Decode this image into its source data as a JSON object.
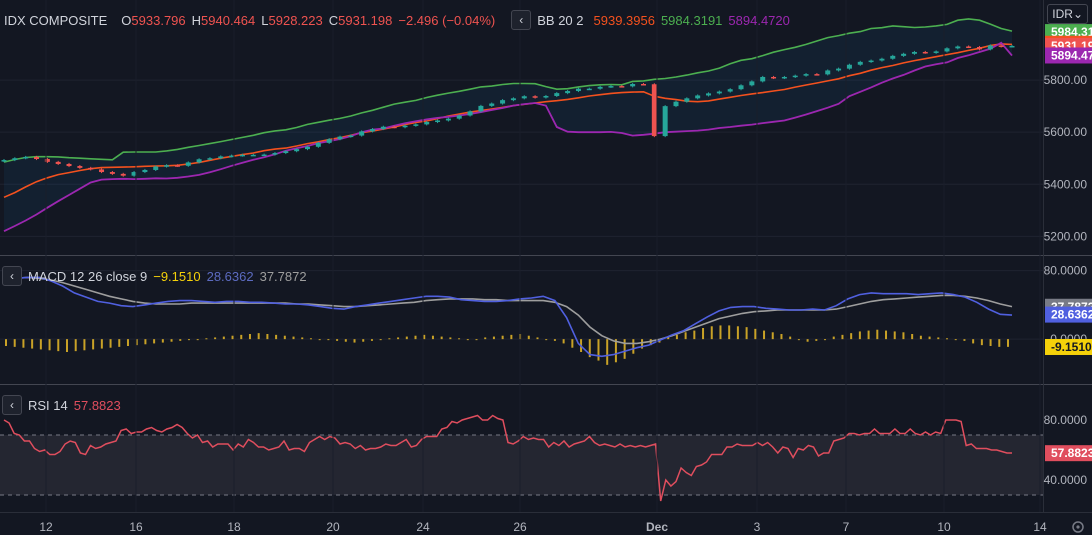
{
  "header": {
    "symbol": "IDX COMPOSITE",
    "o_label": "O",
    "o": "5933.796",
    "h_label": "H",
    "h": "5940.464",
    "l_label": "L",
    "l": "5928.223",
    "c_label": "C",
    "c": "5931.198",
    "change": "−2.496 (−0.04%)",
    "bb_title": "BB 20 2",
    "bb_basis": "5939.3956",
    "bb_upper": "5984.3191",
    "bb_lower": "5894.4720",
    "collapse_glyph": "‹",
    "currency": "IDR"
  },
  "macd_legend": {
    "title": "MACD 12 26 close 9",
    "hist": "−9.1510",
    "macd": "28.6362",
    "signal": "37.7872"
  },
  "rsi_legend": {
    "title": "RSI 14",
    "value": "57.8823"
  },
  "colors": {
    "bg": "#131722",
    "up": "#26a69a",
    "down": "#ef5350",
    "bb_upper": "#4caf50",
    "bb_basis": "#f4511e",
    "bb_lower": "#9c27b0",
    "macd": "#5060e0",
    "signal": "#9e9e9e",
    "hist": "#c9a227",
    "rsi": "#e04e5e"
  },
  "chart_data": [
    {
      "type": "candlestick",
      "title": "IDX COMPOSITE",
      "ylim": [
        5140,
        6000
      ],
      "yticks": [
        "5200.00",
        "5400.00",
        "5600.00",
        "5800.00"
      ],
      "price_labels": [
        {
          "text": "5984.31",
          "value": 5984.3191,
          "color": "#4caf50"
        },
        {
          "text": "5939.39",
          "value": 5939.3956,
          "color": "#f4511e"
        },
        {
          "text": "5931.19",
          "value": 5931.198,
          "color": "#ef5350"
        },
        {
          "text": "5894.47",
          "value": 5894.472,
          "color": "#9c27b0"
        }
      ],
      "closes": [
        5493,
        5500,
        5505,
        5497,
        5486,
        5478,
        5470,
        5463,
        5457,
        5447,
        5440,
        5433,
        5447,
        5455,
        5468,
        5473,
        5471,
        5484,
        5496,
        5500,
        5507,
        5510,
        5513,
        5513,
        5514,
        5520,
        5527,
        5535,
        5544,
        5559,
        5573,
        5583,
        5587,
        5603,
        5612,
        5621,
        5619,
        5625,
        5630,
        5639,
        5645,
        5652,
        5664,
        5680,
        5701,
        5710,
        5723,
        5730,
        5738,
        5733,
        5739,
        5750,
        5758,
        5767,
        5767,
        5774,
        5777,
        5776,
        5785,
        5784,
        5585,
        5700,
        5717,
        5730,
        5741,
        5749,
        5756,
        5765,
        5780,
        5795,
        5812,
        5808,
        5812,
        5817,
        5823,
        5822,
        5837,
        5844,
        5859,
        5870,
        5875,
        5882,
        5893,
        5901,
        5908,
        5905,
        5910,
        5922,
        5929,
        5927,
        5918,
        5933,
        5929,
        5931
      ],
      "upper": [
        5485,
        5495,
        5503,
        5506,
        5506,
        5505,
        5502,
        5500,
        5498,
        5496,
        5494,
        5523,
        5524,
        5524,
        5524,
        5528,
        5534,
        5542,
        5549,
        5556,
        5564,
        5572,
        5580,
        5588,
        5598,
        5605,
        5609,
        5618,
        5630,
        5638,
        5646,
        5653,
        5662,
        5674,
        5684,
        5696,
        5708,
        5715,
        5722,
        5733,
        5742,
        5750,
        5757,
        5765,
        5774,
        5777,
        5783,
        5787,
        5787,
        5786,
        5775,
        5765,
        5767,
        5774,
        5779,
        5782,
        5783,
        5782,
        5795,
        5797,
        5803,
        5806,
        5812,
        5819,
        5828,
        5835,
        5846,
        5863,
        5876,
        5882,
        5894,
        5907,
        5917,
        5926,
        5937,
        5950,
        5963,
        5971,
        5980,
        5986,
        5998,
        6001,
        6008,
        6005,
        6002,
        6004,
        6008,
        6014,
        6030,
        6035,
        6030,
        6015,
        5998,
        5988
      ],
      "basis": [
        5350,
        5368,
        5390,
        5410,
        5425,
        5437,
        5445,
        5453,
        5460,
        5464,
        5465,
        5466,
        5467,
        5469,
        5470,
        5471,
        5473,
        5478,
        5484,
        5492,
        5500,
        5507,
        5514,
        5520,
        5529,
        5535,
        5539,
        5547,
        5556,
        5563,
        5572,
        5579,
        5588,
        5598,
        5604,
        5612,
        5620,
        5629,
        5637,
        5643,
        5652,
        5662,
        5670,
        5677,
        5683,
        5689,
        5695,
        5702,
        5707,
        5712,
        5717,
        5721,
        5726,
        5732,
        5739,
        5744,
        5749,
        5752,
        5754,
        5755,
        5738,
        5730,
        5725,
        5719,
        5717,
        5720,
        5727,
        5734,
        5741,
        5747,
        5752,
        5758,
        5764,
        5773,
        5781,
        5789,
        5797,
        5805,
        5817,
        5826,
        5838,
        5848,
        5856,
        5866,
        5875,
        5882,
        5890,
        5898,
        5905,
        5914,
        5922,
        5933,
        5939,
        5937
      ],
      "lower": [
        5220,
        5240,
        5261,
        5284,
        5310,
        5335,
        5359,
        5383,
        5407,
        5418,
        5420,
        5421,
        5420,
        5421,
        5423,
        5422,
        5425,
        5430,
        5436,
        5446,
        5458,
        5471,
        5483,
        5494,
        5504,
        5515,
        5529,
        5538,
        5547,
        5558,
        5565,
        5574,
        5585,
        5600,
        5610,
        5614,
        5625,
        5634,
        5642,
        5649,
        5655,
        5659,
        5664,
        5670,
        5677,
        5685,
        5693,
        5702,
        5708,
        5712,
        5702,
        5620,
        5602,
        5600,
        5600,
        5600,
        5601,
        5597,
        5587,
        5590,
        5594,
        5600,
        5602,
        5604,
        5606,
        5610,
        5616,
        5620,
        5625,
        5629,
        5635,
        5640,
        5645,
        5656,
        5668,
        5681,
        5694,
        5709,
        5738,
        5755,
        5772,
        5790,
        5806,
        5820,
        5837,
        5852,
        5861,
        5868,
        5885,
        5895,
        5908,
        5920,
        5943,
        5894
      ]
    },
    {
      "type": "line+histogram",
      "title": "MACD 12 26 close 9",
      "ylim": [
        -50,
        90
      ],
      "yticks": [
        "80.0000",
        "0.0000"
      ],
      "price_labels": [
        {
          "text": "37.7872",
          "value": 37.7872,
          "color": "#787b86"
        },
        {
          "text": "28.6362",
          "value": 28.6362,
          "color": "#5060e0"
        },
        {
          "text": "-9.1510",
          "value": -9.151,
          "color": "#f5d10a"
        }
      ],
      "macd": [
        68,
        71,
        72,
        72,
        68,
        62,
        54,
        49,
        44,
        42,
        39,
        38,
        40,
        42,
        44,
        45,
        45,
        44,
        43,
        44,
        44,
        43,
        43,
        42,
        41,
        41,
        40,
        38,
        36,
        35,
        38,
        40,
        42,
        44,
        46,
        48,
        50,
        50,
        49,
        46,
        45,
        44,
        44,
        45,
        47,
        48,
        50,
        45,
        25,
        -5,
        -18,
        -20,
        -18,
        -14,
        -10,
        -7,
        -1,
        5,
        10,
        18,
        26,
        33,
        37,
        38,
        38,
        36,
        35,
        34,
        34,
        35,
        34,
        39,
        47,
        52,
        54,
        53,
        53,
        53,
        52,
        53,
        54,
        52,
        49,
        43,
        35,
        29,
        28
      ],
      "signal": [
        70,
        71,
        72,
        71,
        69,
        66,
        62,
        58,
        54,
        50,
        47,
        44,
        42,
        41,
        41,
        41,
        42,
        42,
        42,
        42,
        42,
        42,
        42,
        42,
        42,
        41,
        41,
        40,
        39,
        38,
        38,
        39,
        40,
        41,
        42,
        43,
        45,
        46,
        47,
        47,
        47,
        46,
        46,
        45,
        45,
        45,
        45,
        43,
        38,
        28,
        14,
        4,
        -2,
        -5,
        -5,
        -3,
        0,
        4,
        9,
        14,
        19,
        24,
        27,
        30,
        32,
        33,
        34,
        34,
        34,
        34,
        34,
        35,
        38,
        41,
        44,
        46,
        47,
        48,
        49,
        50,
        51,
        51,
        50,
        48,
        45,
        41,
        38
      ],
      "hist": [
        -8,
        -9,
        -10,
        -11,
        -12,
        -13,
        -14,
        -15,
        -14,
        -13,
        -12,
        -11,
        -10,
        -9,
        -8,
        -7,
        -6,
        -5,
        -4,
        -3,
        -2,
        -1,
        0,
        1,
        2,
        3,
        4,
        5,
        6,
        7,
        6,
        5,
        4,
        3,
        2,
        1,
        0,
        -1,
        -2,
        -3,
        -4,
        -3,
        -2,
        -1,
        1,
        2,
        3,
        4,
        5,
        4,
        3,
        2,
        1,
        0,
        -1,
        2,
        3,
        4,
        5,
        6,
        4,
        2,
        0,
        -2,
        -5,
        -10,
        -15,
        -21,
        -25,
        -30,
        -27,
        -23,
        -17,
        -11,
        -7,
        -4,
        2,
        5,
        8,
        10,
        13,
        15,
        16,
        16,
        15,
        14,
        12,
        10,
        8,
        6,
        3,
        0,
        -3,
        -2,
        0,
        3,
        5,
        7,
        9,
        10,
        11,
        10,
        9,
        8,
        6,
        4,
        3,
        2,
        1,
        0,
        -2,
        -5,
        -7,
        -8,
        -9,
        -9
      ]
    },
    {
      "type": "line",
      "title": "RSI 14",
      "ylim": [
        20,
        100
      ],
      "yticks": [
        "80.0000",
        "40.0000"
      ],
      "bands": [
        70,
        30
      ],
      "price_labels": [
        {
          "text": "57.8823",
          "value": 57.8823,
          "color": "#e04e5e"
        }
      ],
      "values": [
        80,
        78,
        71,
        70,
        66,
        66,
        61,
        59,
        60,
        57,
        57,
        59,
        64,
        66,
        65,
        58,
        57,
        63,
        61,
        62,
        64,
        65,
        66,
        73,
        74,
        71,
        72,
        72,
        74,
        75,
        73,
        72,
        74,
        75,
        77,
        75,
        71,
        68,
        70,
        65,
        66,
        62,
        64,
        64,
        64,
        60,
        64,
        62,
        67,
        65,
        62,
        62,
        60,
        61,
        62,
        66,
        60,
        61,
        61,
        59,
        65,
        67,
        69,
        67,
        69,
        68,
        64,
        65,
        64,
        61,
        63,
        60,
        61,
        61,
        62,
        64,
        63,
        63,
        65,
        67,
        62,
        63,
        67,
        69,
        69,
        69,
        74,
        75,
        79,
        78,
        80,
        81,
        82,
        83,
        80,
        80,
        83,
        81,
        80,
        65,
        64,
        66,
        69,
        67,
        68,
        67,
        67,
        62,
        65,
        63,
        66,
        62,
        64,
        65,
        66,
        69,
        65,
        63,
        64,
        63,
        62,
        64,
        62,
        63,
        62,
        63,
        62,
        63,
        64,
        26,
        40,
        36,
        39,
        48,
        45,
        43,
        49,
        50,
        52,
        57,
        57,
        57,
        62,
        62,
        64,
        63,
        63,
        63,
        65,
        63,
        65,
        62,
        58,
        62,
        61,
        55,
        61,
        60,
        63,
        62,
        56,
        58,
        58,
        66,
        67,
        68,
        71,
        71,
        70,
        71,
        71,
        74,
        71,
        71,
        71,
        74,
        71,
        71,
        74,
        71,
        70,
        72,
        70,
        72,
        71,
        80,
        80,
        80,
        79,
        63,
        64,
        61,
        61,
        61,
        60,
        60,
        59,
        58,
        58
      ]
    }
  ],
  "xaxis": {
    "labels": [
      "12",
      "16",
      "18",
      "20",
      "24",
      "26",
      "Dec",
      "3",
      "7",
      "10",
      "14"
    ]
  }
}
